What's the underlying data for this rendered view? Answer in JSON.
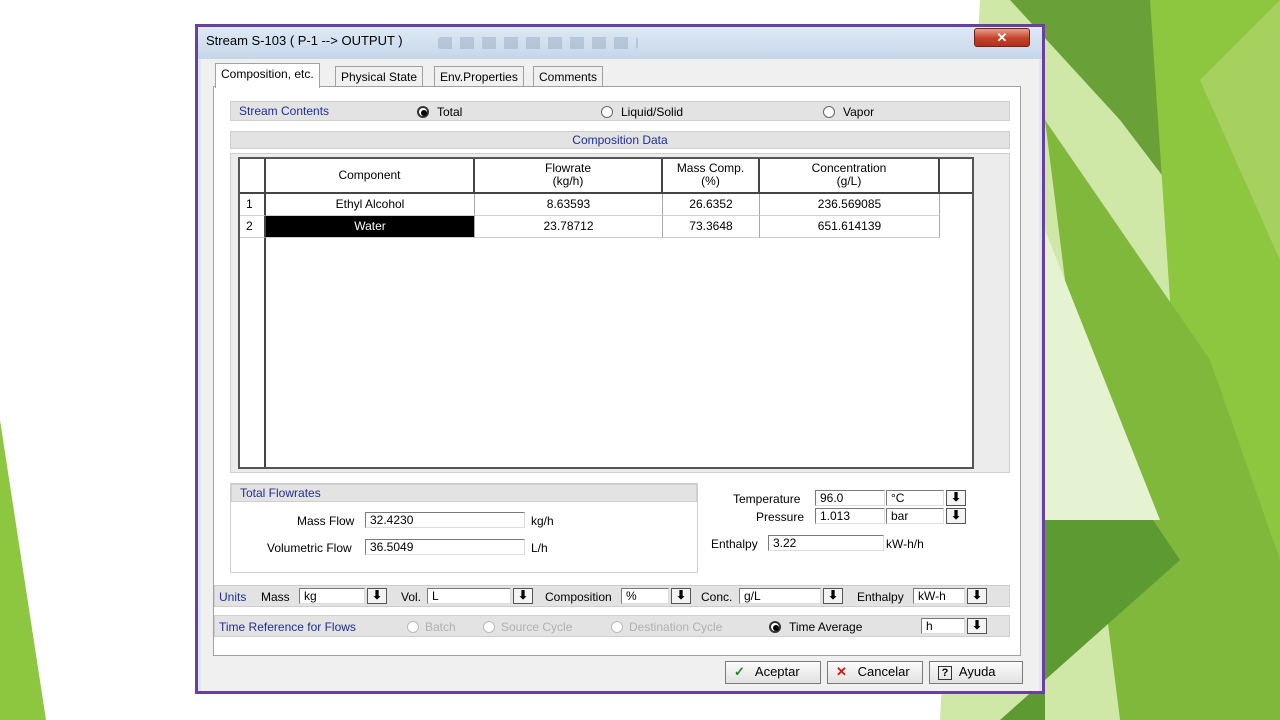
{
  "window": {
    "title": "Stream S-103 ( P-1 --> OUTPUT )",
    "close_glyph": "✕"
  },
  "tabs": [
    {
      "label": "Composition, etc."
    },
    {
      "label": "Physical State"
    },
    {
      "label": "Env.Properties"
    },
    {
      "label": "Comments"
    }
  ],
  "stream_contents": {
    "label": "Stream Contents",
    "options": [
      {
        "label": "Total",
        "selected": true
      },
      {
        "label": "Liquid/Solid",
        "selected": false
      },
      {
        "label": "Vapor",
        "selected": false
      }
    ]
  },
  "composition": {
    "header": "Composition Data",
    "columns": [
      {
        "line1": "Component",
        "line2": ""
      },
      {
        "line1": "Flowrate",
        "line2": "(kg/h)"
      },
      {
        "line1": "Mass Comp.",
        "line2": "(%)"
      },
      {
        "line1": "Concentration",
        "line2": "(g/L)"
      }
    ],
    "rows": [
      {
        "num": "1",
        "component": "Ethyl Alcohol",
        "flowrate": "8.63593",
        "mass_comp": "26.6352",
        "concentration": "236.569085"
      },
      {
        "num": "2",
        "component": "Water",
        "flowrate": "23.78712",
        "mass_comp": "73.3648",
        "concentration": "651.614139"
      }
    ]
  },
  "total_flowrates": {
    "label": "Total Flowrates",
    "mass_flow": {
      "label": "Mass Flow",
      "value": "32.4230",
      "unit": "kg/h"
    },
    "volumetric_flow": {
      "label": "Volumetric Flow",
      "value": "36.5049",
      "unit": "L/h"
    }
  },
  "conditions": {
    "temperature": {
      "label": "Temperature",
      "value": "96.0",
      "unit": "°C"
    },
    "pressure": {
      "label": "Pressure",
      "value": "1.013",
      "unit": "bar"
    },
    "enthalpy": {
      "label": "Enthalpy",
      "value": "3.22",
      "unit": "kW-h/h"
    }
  },
  "units": {
    "label": "Units",
    "mass": {
      "label": "Mass",
      "value": "kg"
    },
    "vol": {
      "label": "Vol.",
      "value": "L"
    },
    "composition": {
      "label": "Composition",
      "value": "%"
    },
    "conc": {
      "label": "Conc.",
      "value": "g/L"
    },
    "enthalpy": {
      "label": "Enthalpy",
      "value": "kW-h"
    }
  },
  "time_reference": {
    "label": "Time Reference for Flows",
    "options": [
      {
        "label": "Batch",
        "enabled": false,
        "selected": false
      },
      {
        "label": "Source Cycle",
        "enabled": false,
        "selected": false
      },
      {
        "label": "Destination Cycle",
        "enabled": false,
        "selected": false
      },
      {
        "label": "Time Average",
        "enabled": true,
        "selected": true
      }
    ],
    "unit_value": "h"
  },
  "dropdown_glyph": "⬇",
  "buttons": {
    "ok": {
      "icon": "✓",
      "label": "Aceptar"
    },
    "cancel": {
      "icon": "✕",
      "label": "Cancelar"
    },
    "help": {
      "icon": "?",
      "label": "Ayuda"
    }
  },
  "colors": {
    "accent_label": "#1f2f95",
    "window_border": "#6b3fa0",
    "slide_green": "#8dc63f"
  }
}
